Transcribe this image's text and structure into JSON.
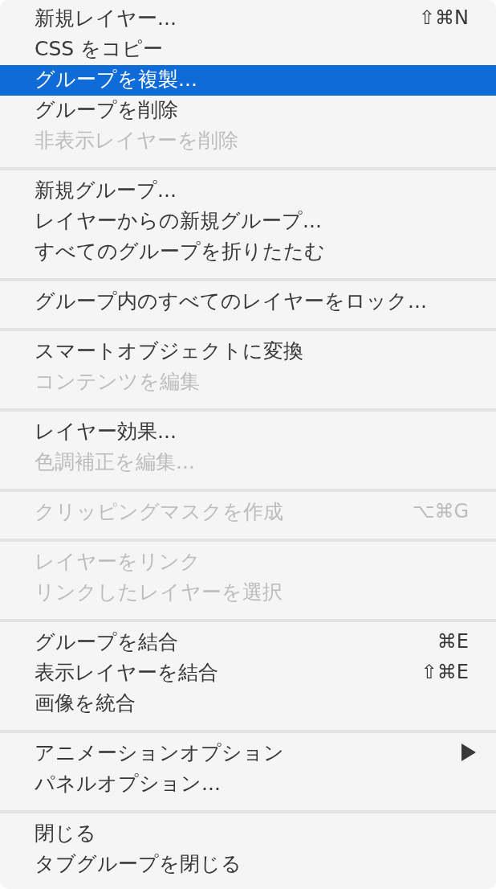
{
  "menu": {
    "groups": [
      {
        "items": [
          {
            "label": "新規レイヤー...",
            "shortcut": "⇧⌘N",
            "selected": false,
            "disabled": false,
            "submenu": false
          },
          {
            "label": "CSS をコピー",
            "selected": false,
            "disabled": false,
            "submenu": false
          },
          {
            "label": "グループを複製...",
            "selected": true,
            "disabled": false,
            "submenu": false
          },
          {
            "label": "グループを削除",
            "selected": false,
            "disabled": false,
            "submenu": false
          },
          {
            "label": "非表示レイヤーを削除",
            "selected": false,
            "disabled": true,
            "submenu": false
          }
        ]
      },
      {
        "items": [
          {
            "label": "新規グループ...",
            "selected": false,
            "disabled": false,
            "submenu": false
          },
          {
            "label": "レイヤーからの新規グループ...",
            "selected": false,
            "disabled": false,
            "submenu": false
          },
          {
            "label": "すべてのグループを折りたたむ",
            "selected": false,
            "disabled": false,
            "submenu": false
          }
        ]
      },
      {
        "items": [
          {
            "label": "グループ内のすべてのレイヤーをロック...",
            "selected": false,
            "disabled": false,
            "submenu": false
          }
        ]
      },
      {
        "items": [
          {
            "label": "スマートオブジェクトに変換",
            "selected": false,
            "disabled": false,
            "submenu": false
          },
          {
            "label": "コンテンツを編集",
            "selected": false,
            "disabled": true,
            "submenu": false
          }
        ]
      },
      {
        "items": [
          {
            "label": "レイヤー効果...",
            "selected": false,
            "disabled": false,
            "submenu": false
          },
          {
            "label": "色調補正を編集...",
            "selected": false,
            "disabled": true,
            "submenu": false
          }
        ]
      },
      {
        "items": [
          {
            "label": "クリッピングマスクを作成",
            "shortcut": "⌥⌘G",
            "selected": false,
            "disabled": true,
            "submenu": false
          }
        ]
      },
      {
        "items": [
          {
            "label": "レイヤーをリンク",
            "selected": false,
            "disabled": true,
            "submenu": false
          },
          {
            "label": "リンクしたレイヤーを選択",
            "selected": false,
            "disabled": true,
            "submenu": false
          }
        ]
      },
      {
        "items": [
          {
            "label": "グループを結合",
            "shortcut": "⌘E",
            "selected": false,
            "disabled": false,
            "submenu": false
          },
          {
            "label": "表示レイヤーを結合",
            "shortcut": "⇧⌘E",
            "selected": false,
            "disabled": false,
            "submenu": false
          },
          {
            "label": "画像を統合",
            "selected": false,
            "disabled": false,
            "submenu": false
          }
        ]
      },
      {
        "items": [
          {
            "label": "アニメーションオプション",
            "selected": false,
            "disabled": false,
            "submenu": true
          },
          {
            "label": "パネルオプション...",
            "selected": false,
            "disabled": false,
            "submenu": false
          }
        ]
      },
      {
        "items": [
          {
            "label": "閉じる",
            "selected": false,
            "disabled": false,
            "submenu": false
          },
          {
            "label": "タブグループを閉じる",
            "selected": false,
            "disabled": false,
            "submenu": false
          }
        ]
      }
    ]
  }
}
